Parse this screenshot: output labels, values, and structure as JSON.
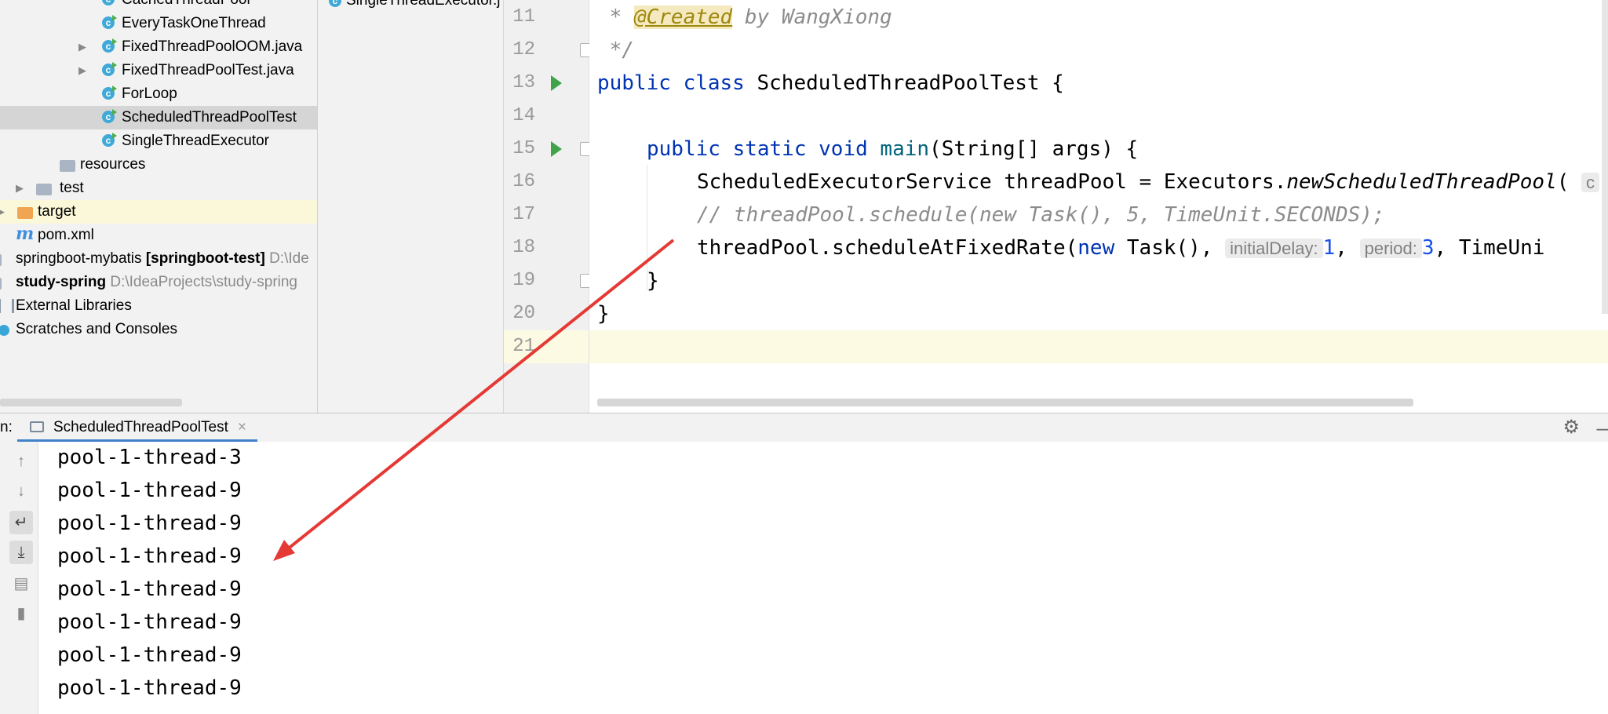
{
  "project_tree": {
    "items": [
      {
        "label": "CachedThreadPool",
        "type": "class"
      },
      {
        "label": "EveryTaskOneThread",
        "type": "class"
      },
      {
        "label": "FixedThreadPoolOOM.java",
        "type": "class"
      },
      {
        "label": "FixedThreadPoolTest.java",
        "type": "class"
      },
      {
        "label": "ForLoop",
        "type": "class"
      },
      {
        "label": "ScheduledThreadPoolTest",
        "type": "class",
        "selected": true
      },
      {
        "label": "SingleThreadExecutor",
        "type": "class"
      },
      {
        "label": "resources",
        "type": "folder"
      },
      {
        "label": "test",
        "type": "folder"
      },
      {
        "label": "target",
        "type": "folder"
      },
      {
        "label": "pom.xml",
        "type": "maven"
      },
      {
        "label": "springboot-mybatis",
        "bold": "[springboot-test]",
        "path": "D:\\Ide"
      },
      {
        "label": "study-spring",
        "path": "D:\\IdeaProjects\\study-spring"
      },
      {
        "label": "External Libraries"
      },
      {
        "label": "Scratches and Consoles"
      }
    ]
  },
  "editor_tab": {
    "label": "SingleThreadExecutor.j"
  },
  "editor": {
    "line_numbers": [
      "11",
      "12",
      "13",
      "14",
      "15",
      "16",
      "17",
      "18",
      "19",
      "20",
      "21"
    ],
    "lines": {
      "l11_star": " * ",
      "l11_ann": "@Created",
      "l11_rest": " by WangXiong",
      "l12": " */",
      "l13_kw": "public class ",
      "l13_rest": "ScheduledThreadPoolTest {",
      "l15_kw": "public static void ",
      "l15_fn": "main",
      "l15_rest": "(String[] args) {",
      "l16_a": "ScheduledExecutorService threadPool = Executors.",
      "l16_b": "newScheduledThreadPool",
      "l16_c": "( ",
      "l16_hint": "c",
      "l17": "// threadPool.schedule(new Task(), 5, TimeUnit.SECONDS);",
      "l18_a": "threadPool.scheduleAtFixedRate(",
      "l18_new": "new",
      "l18_b": " Task(), ",
      "l18_hint1": "initialDelay:",
      "l18_v1": "1",
      "l18_c": ", ",
      "l18_hint2": "period:",
      "l18_v2": "3",
      "l18_d": ", TimeUni",
      "l19": "}",
      "l20": "}"
    }
  },
  "run_panel": {
    "prefix": "n:",
    "tab_label": "ScheduledThreadPoolTest",
    "close": "×",
    "output": [
      "pool-1-thread-3",
      "pool-1-thread-9",
      "pool-1-thread-9",
      "pool-1-thread-9",
      "pool-1-thread-9",
      "pool-1-thread-9",
      "pool-1-thread-9",
      "pool-1-thread-9"
    ]
  },
  "colors": {
    "keyword": "#0033b3",
    "comment": "#8c8c8c",
    "annotation": "#9e880d",
    "number": "#1750eb",
    "selection": "#d5d5d5",
    "arrow": "#e53935"
  }
}
